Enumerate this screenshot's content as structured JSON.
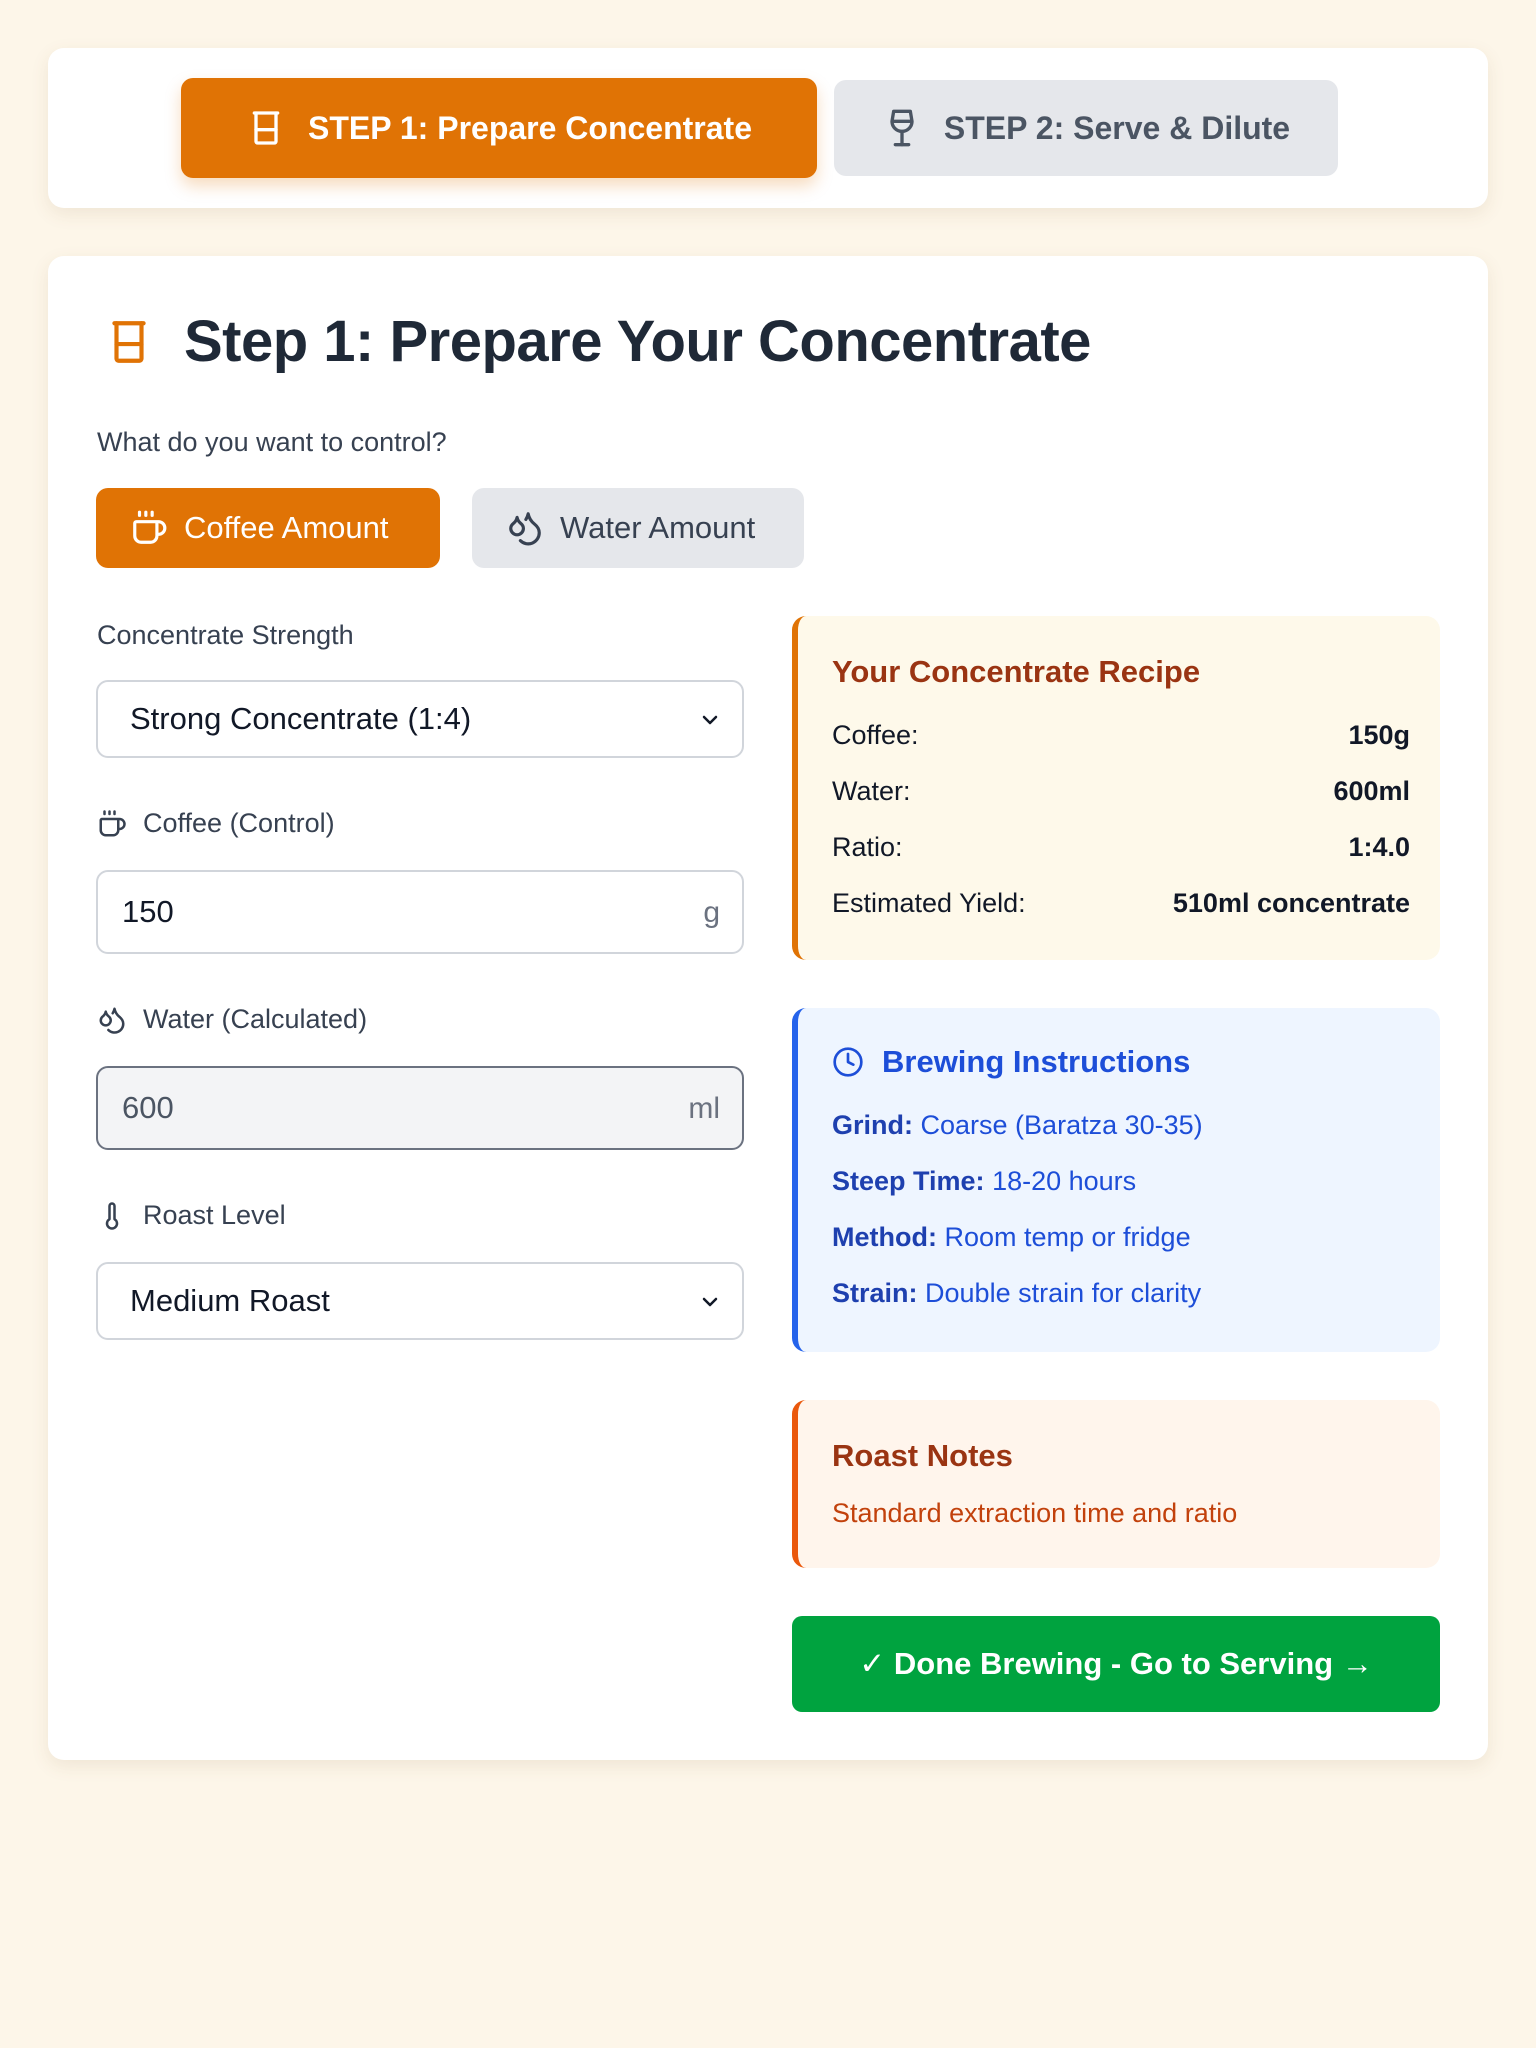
{
  "steps": {
    "step1_label": "STEP 1: Prepare Concentrate",
    "step2_label": "STEP 2: Serve & Dilute"
  },
  "main": {
    "title": "Step 1: Prepare Your Concentrate",
    "control_question": "What do you want to control?",
    "mode_coffee_label": "Coffee Amount",
    "mode_water_label": "Water Amount",
    "strength_label": "Concentrate Strength",
    "strength_value": "Strong Concentrate (1:4)",
    "coffee_label": "Coffee (Control)",
    "coffee_value": "150",
    "coffee_unit": "g",
    "water_label": "Water (Calculated)",
    "water_value": "600",
    "water_unit": "ml",
    "roast_label": "Roast Level",
    "roast_value": "Medium Roast"
  },
  "recipe": {
    "title": "Your Concentrate Recipe",
    "rows": [
      {
        "label": "Coffee:",
        "value": "150g"
      },
      {
        "label": "Water:",
        "value": "600ml"
      },
      {
        "label": "Ratio:",
        "value": "1:4.0"
      },
      {
        "label": "Estimated Yield:",
        "value": "510ml concentrate"
      }
    ]
  },
  "instructions": {
    "title": "Brewing Instructions",
    "rows": [
      {
        "key": "Grind:",
        "value": "Coarse (Baratza 30-35)"
      },
      {
        "key": "Steep Time:",
        "value": "18-20 hours"
      },
      {
        "key": "Method:",
        "value": "Room temp or fridge"
      },
      {
        "key": "Strain:",
        "value": "Double strain for clarity"
      }
    ]
  },
  "notes": {
    "title": "Roast Notes",
    "text": "Standard extraction time and ratio"
  },
  "done_button_label": "✓ Done Brewing - Go to Serving →",
  "colors": {
    "accent": "#e07305",
    "success": "#00a33f",
    "info": "#2563eb",
    "background": "#fdf6e9"
  }
}
